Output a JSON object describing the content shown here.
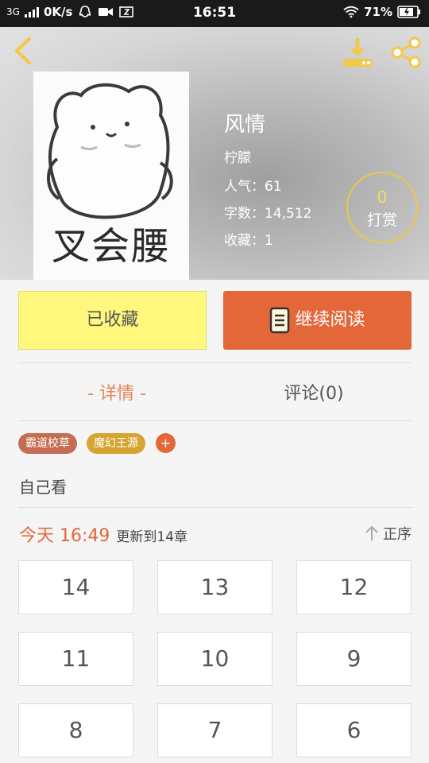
{
  "status_bar": {
    "network": "3G",
    "speed": "0K/s",
    "time": "16:51",
    "battery": "71%",
    "icons": [
      "signal-icon",
      "qq-icon",
      "video-icon",
      "screenshot-icon",
      "wifi-icon",
      "battery-icon"
    ]
  },
  "header": {
    "back_icon": "back-arrow-icon",
    "download_icon": "download-icon",
    "share_icon": "share-icon",
    "accent_color": "#e9c94a"
  },
  "book": {
    "cover_text": "叉会腰",
    "title": "风情",
    "author": "柠朦",
    "popularity": "人气：61",
    "word_count": "字数：14,512",
    "favorites": "收藏：1"
  },
  "tip": {
    "count": "0",
    "label": "打赏"
  },
  "actions": {
    "collect": "已收藏",
    "read": "继续阅读"
  },
  "tabs": [
    {
      "label": "- 详情 -",
      "active": true
    },
    {
      "label": "评论(0)",
      "active": false
    }
  ],
  "tags": [
    {
      "label": "霸道校草",
      "color": "#c56d52"
    },
    {
      "label": "魔幻王源",
      "color": "#d6a531"
    }
  ],
  "tag_add": "+",
  "description": "自己看",
  "update": {
    "time": "今天 16:49",
    "chapters": "更新到14章",
    "sort_label": "正序"
  },
  "chapters": [
    "14",
    "13",
    "12",
    "11",
    "10",
    "9",
    "8",
    "7",
    "6"
  ]
}
